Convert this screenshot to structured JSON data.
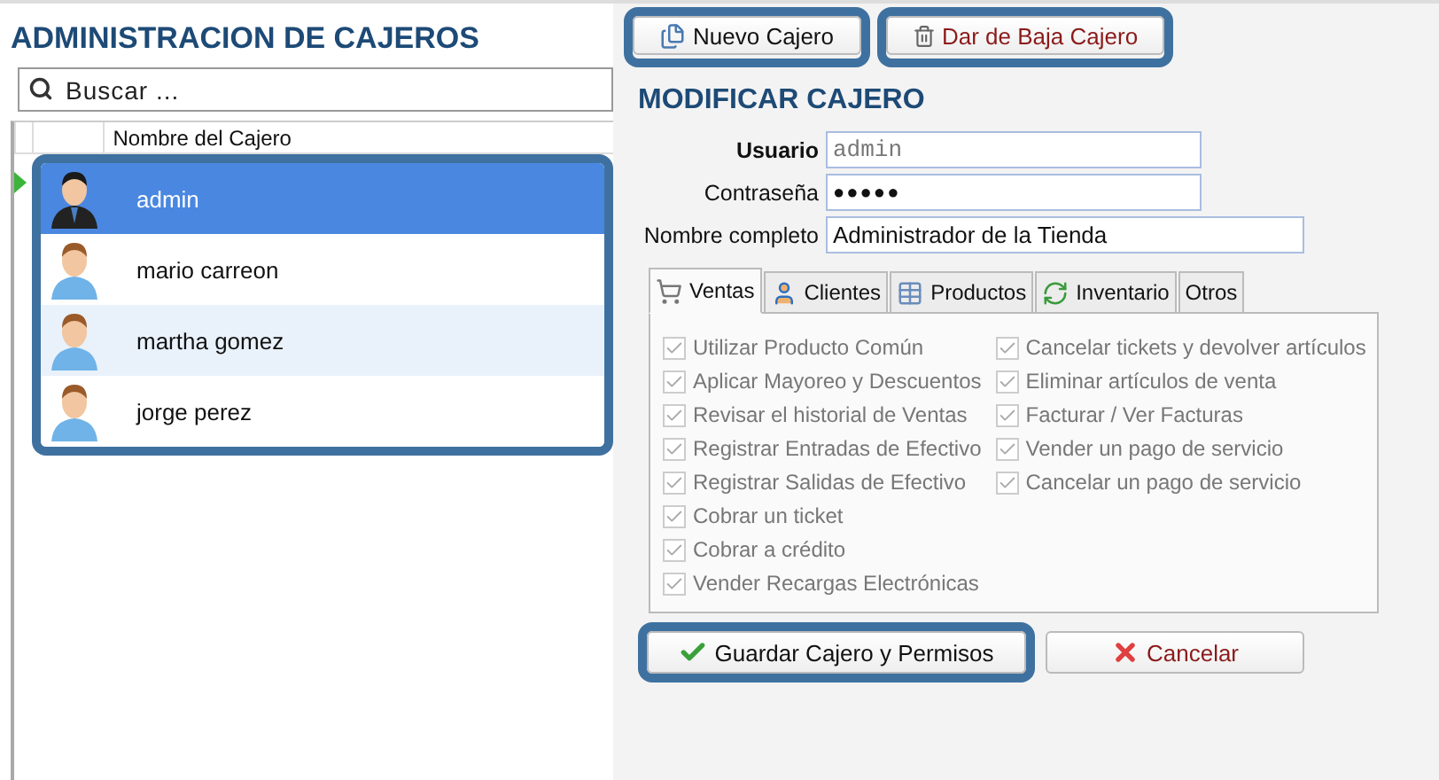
{
  "title": "ADMINISTRACION DE CAJEROS",
  "search": {
    "placeholder": "Buscar ..."
  },
  "list": {
    "column": "Nombre del Cajero",
    "highlighted": true,
    "rows": [
      {
        "name": "admin",
        "kind": "manager",
        "selected": true
      },
      {
        "name": "mario carreon",
        "kind": "user",
        "selected": false
      },
      {
        "name": "martha gomez",
        "kind": "user",
        "selected": false
      },
      {
        "name": "jorge perez",
        "kind": "user",
        "selected": false
      }
    ]
  },
  "toolbar": [
    {
      "label": "Nuevo Cajero",
      "kind": "new",
      "highlighted": true
    },
    {
      "label": "Dar de Baja Cajero",
      "kind": "delete",
      "highlighted": true
    }
  ],
  "form": {
    "title": "MODIFICAR CAJERO",
    "fields": [
      {
        "label": "Usuario",
        "value": "admin",
        "kind": "readonly",
        "bold": true
      },
      {
        "label": "Contraseña",
        "value": "●●●●●",
        "kind": "password",
        "bold": false
      },
      {
        "label": "Nombre completo",
        "value": "Administrador de la Tienda",
        "kind": "wide",
        "bold": false
      }
    ]
  },
  "tabs": [
    {
      "label": "Ventas",
      "kind": "cart",
      "selected": true
    },
    {
      "label": "Clientes",
      "kind": "person",
      "selected": false
    },
    {
      "label": "Productos",
      "kind": "table",
      "selected": false
    },
    {
      "label": "Inventario",
      "kind": "refresh",
      "selected": false
    },
    {
      "label": "Otros",
      "kind": "none",
      "selected": false
    }
  ],
  "permissions": {
    "disabled": true,
    "columns": [
      [
        {
          "label": "Utilizar Producto Común",
          "checked": true
        },
        {
          "label": "Aplicar Mayoreo y Descuentos",
          "checked": true
        },
        {
          "label": "Revisar el historial de Ventas",
          "checked": true
        },
        {
          "label": "Registrar Entradas de Efectivo",
          "checked": true
        },
        {
          "label": "Registrar Salidas de Efectivo",
          "checked": true
        },
        {
          "label": "Cobrar un ticket",
          "checked": true
        },
        {
          "label": "Cobrar a crédito",
          "checked": true
        },
        {
          "label": "Vender Recargas Electrónicas",
          "checked": true
        }
      ],
      [
        {
          "label": "Cancelar tickets y devolver artículos",
          "checked": true
        },
        {
          "label": "Eliminar artículos de venta",
          "checked": true
        },
        {
          "label": "Facturar / Ver Facturas",
          "checked": true
        },
        {
          "label": "Vender un pago de servicio",
          "checked": true
        },
        {
          "label": "Cancelar un pago de servicio",
          "checked": true
        }
      ]
    ]
  },
  "actions": [
    {
      "label": "Guardar Cajero y Permisos",
      "kind": "save",
      "highlighted": true
    },
    {
      "label": "Cancelar",
      "kind": "cancel",
      "highlighted": false
    }
  ]
}
